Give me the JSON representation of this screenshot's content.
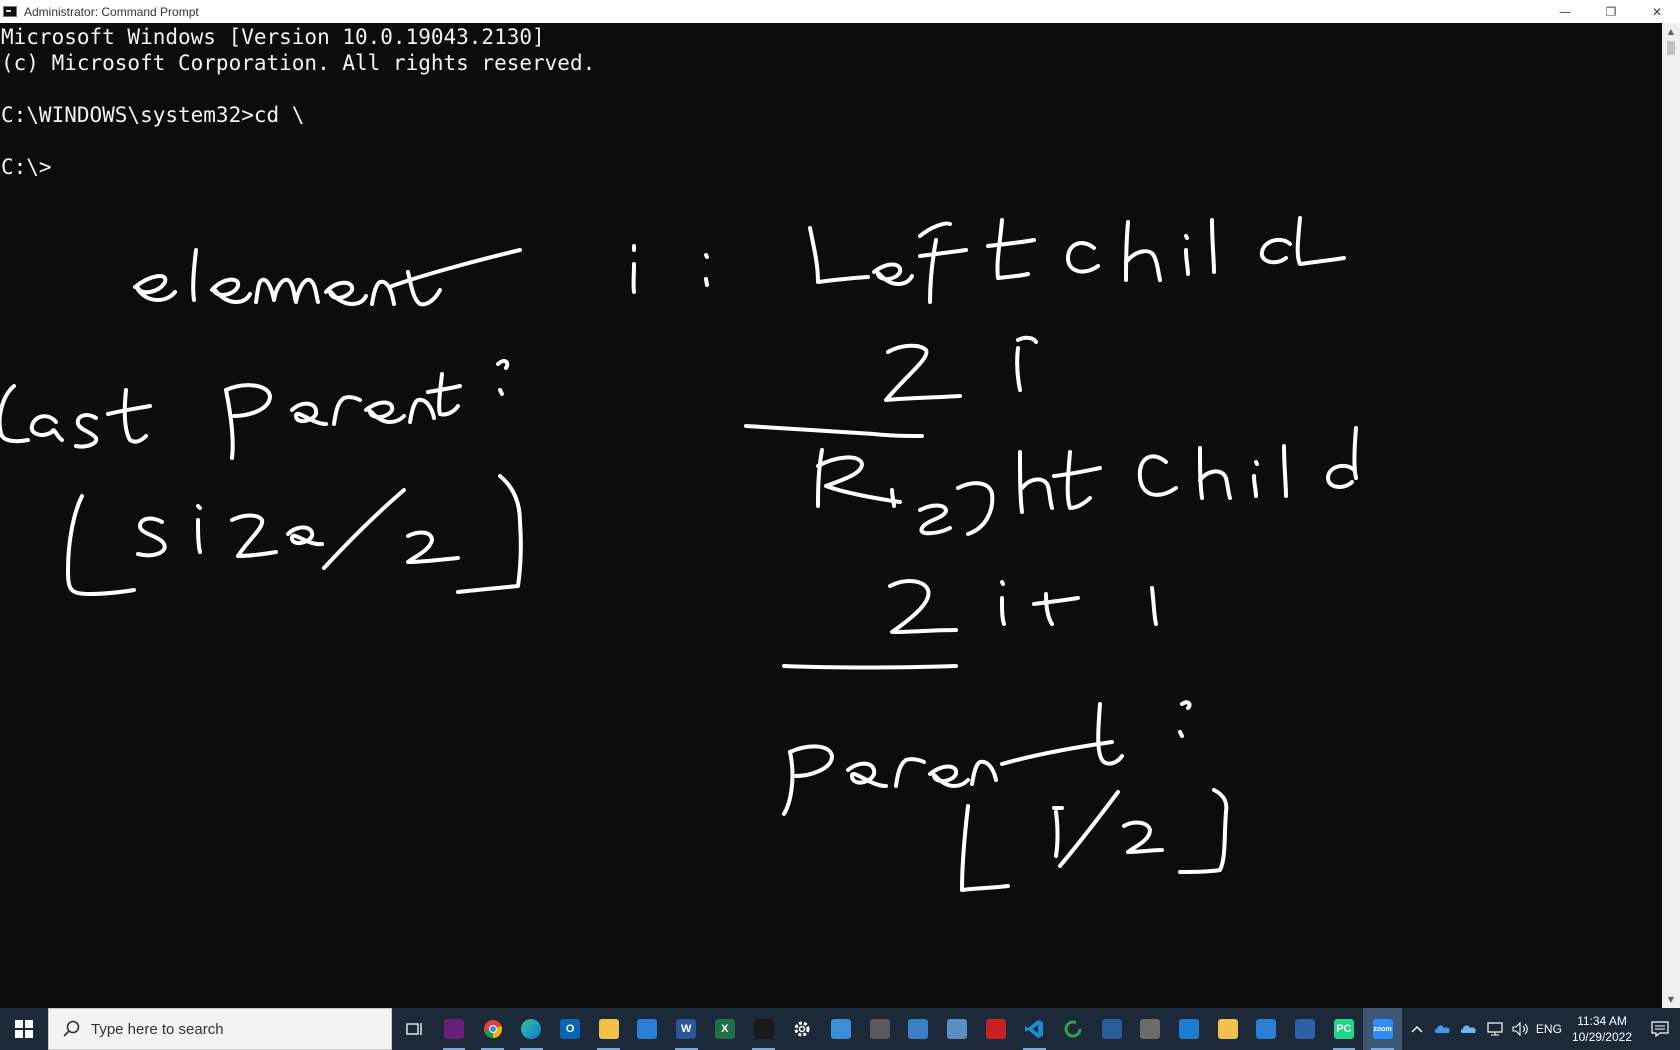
{
  "window": {
    "title": "Administrator: Command Prompt",
    "controls": {
      "minimize": "—",
      "restore": "❐",
      "close": "✕"
    }
  },
  "console": {
    "lines": [
      "Microsoft Windows [Version 10.0.19043.2130]",
      "(c) Microsoft Corporation. All rights reserved.",
      "",
      "C:\\WINDOWS\\system32>cd \\",
      "",
      "C:\\>"
    ]
  },
  "handwriting": {
    "element": "element i :",
    "left_child": "Left Child",
    "left_formula": "2i",
    "right_child": "Right Child",
    "right_formula": "2i+1",
    "parent": "Parent :",
    "parent_formula": "⌊i/2⌋",
    "last_parent": "Last parent :",
    "last_parent_formula": "⌊size/2⌋"
  },
  "taskbar": {
    "search_placeholder": "Type here to search",
    "apps": [
      {
        "icon": "task-view-icon"
      },
      {
        "icon": "visual-studio-icon",
        "color": "#68217a"
      },
      {
        "icon": "chrome-icon"
      },
      {
        "icon": "edge-icon",
        "color": "#0f7bd4"
      },
      {
        "icon": "outlook-icon",
        "color": "#0a64b5",
        "text": "O"
      },
      {
        "icon": "file-explorer-icon",
        "color": "#f2c14b"
      },
      {
        "icon": "store-icon",
        "color": "#2a7fd4"
      },
      {
        "icon": "word-icon",
        "color": "#2b579a",
        "text": "W"
      },
      {
        "icon": "excel-icon",
        "color": "#1e7145",
        "text": "X"
      },
      {
        "icon": "terminal-icon",
        "color": "#1a1a1a"
      },
      {
        "icon": "settings-icon"
      },
      {
        "icon": "remote-desktop-icon",
        "color": "#3a8fd8"
      },
      {
        "icon": "calculator-icon",
        "color": "#5a5a5a"
      },
      {
        "icon": "control-panel-icon",
        "color": "#3b7fc4"
      },
      {
        "icon": "network-icon",
        "color": "#5a8fc4"
      },
      {
        "icon": "acrobat-icon",
        "color": "#c8201e"
      },
      {
        "icon": "vscode-icon",
        "color": "#1f8ad2"
      },
      {
        "icon": "refresh-app-icon",
        "color": "#2fa44a"
      },
      {
        "icon": "wireshark-icon",
        "color": "#2a5c9c"
      },
      {
        "icon": "pen-tool-icon",
        "color": "#6b6b6b"
      },
      {
        "icon": "snip-icon",
        "color": "#1d7bd2"
      },
      {
        "icon": "python-icon",
        "color": "#f2c14b"
      },
      {
        "icon": "notepad-icon",
        "color": "#2a7fd4"
      },
      {
        "icon": "powershell-icon",
        "color": "#2f5fa8"
      },
      {
        "icon": "pycharm-icon",
        "color": "#21d789",
        "text": "PC"
      },
      {
        "icon": "zoom-icon",
        "color": "#2d8cff",
        "text": "zoom"
      }
    ],
    "tray": {
      "language": "ENG",
      "time": "11:34 AM",
      "date": "10/29/2022"
    }
  }
}
